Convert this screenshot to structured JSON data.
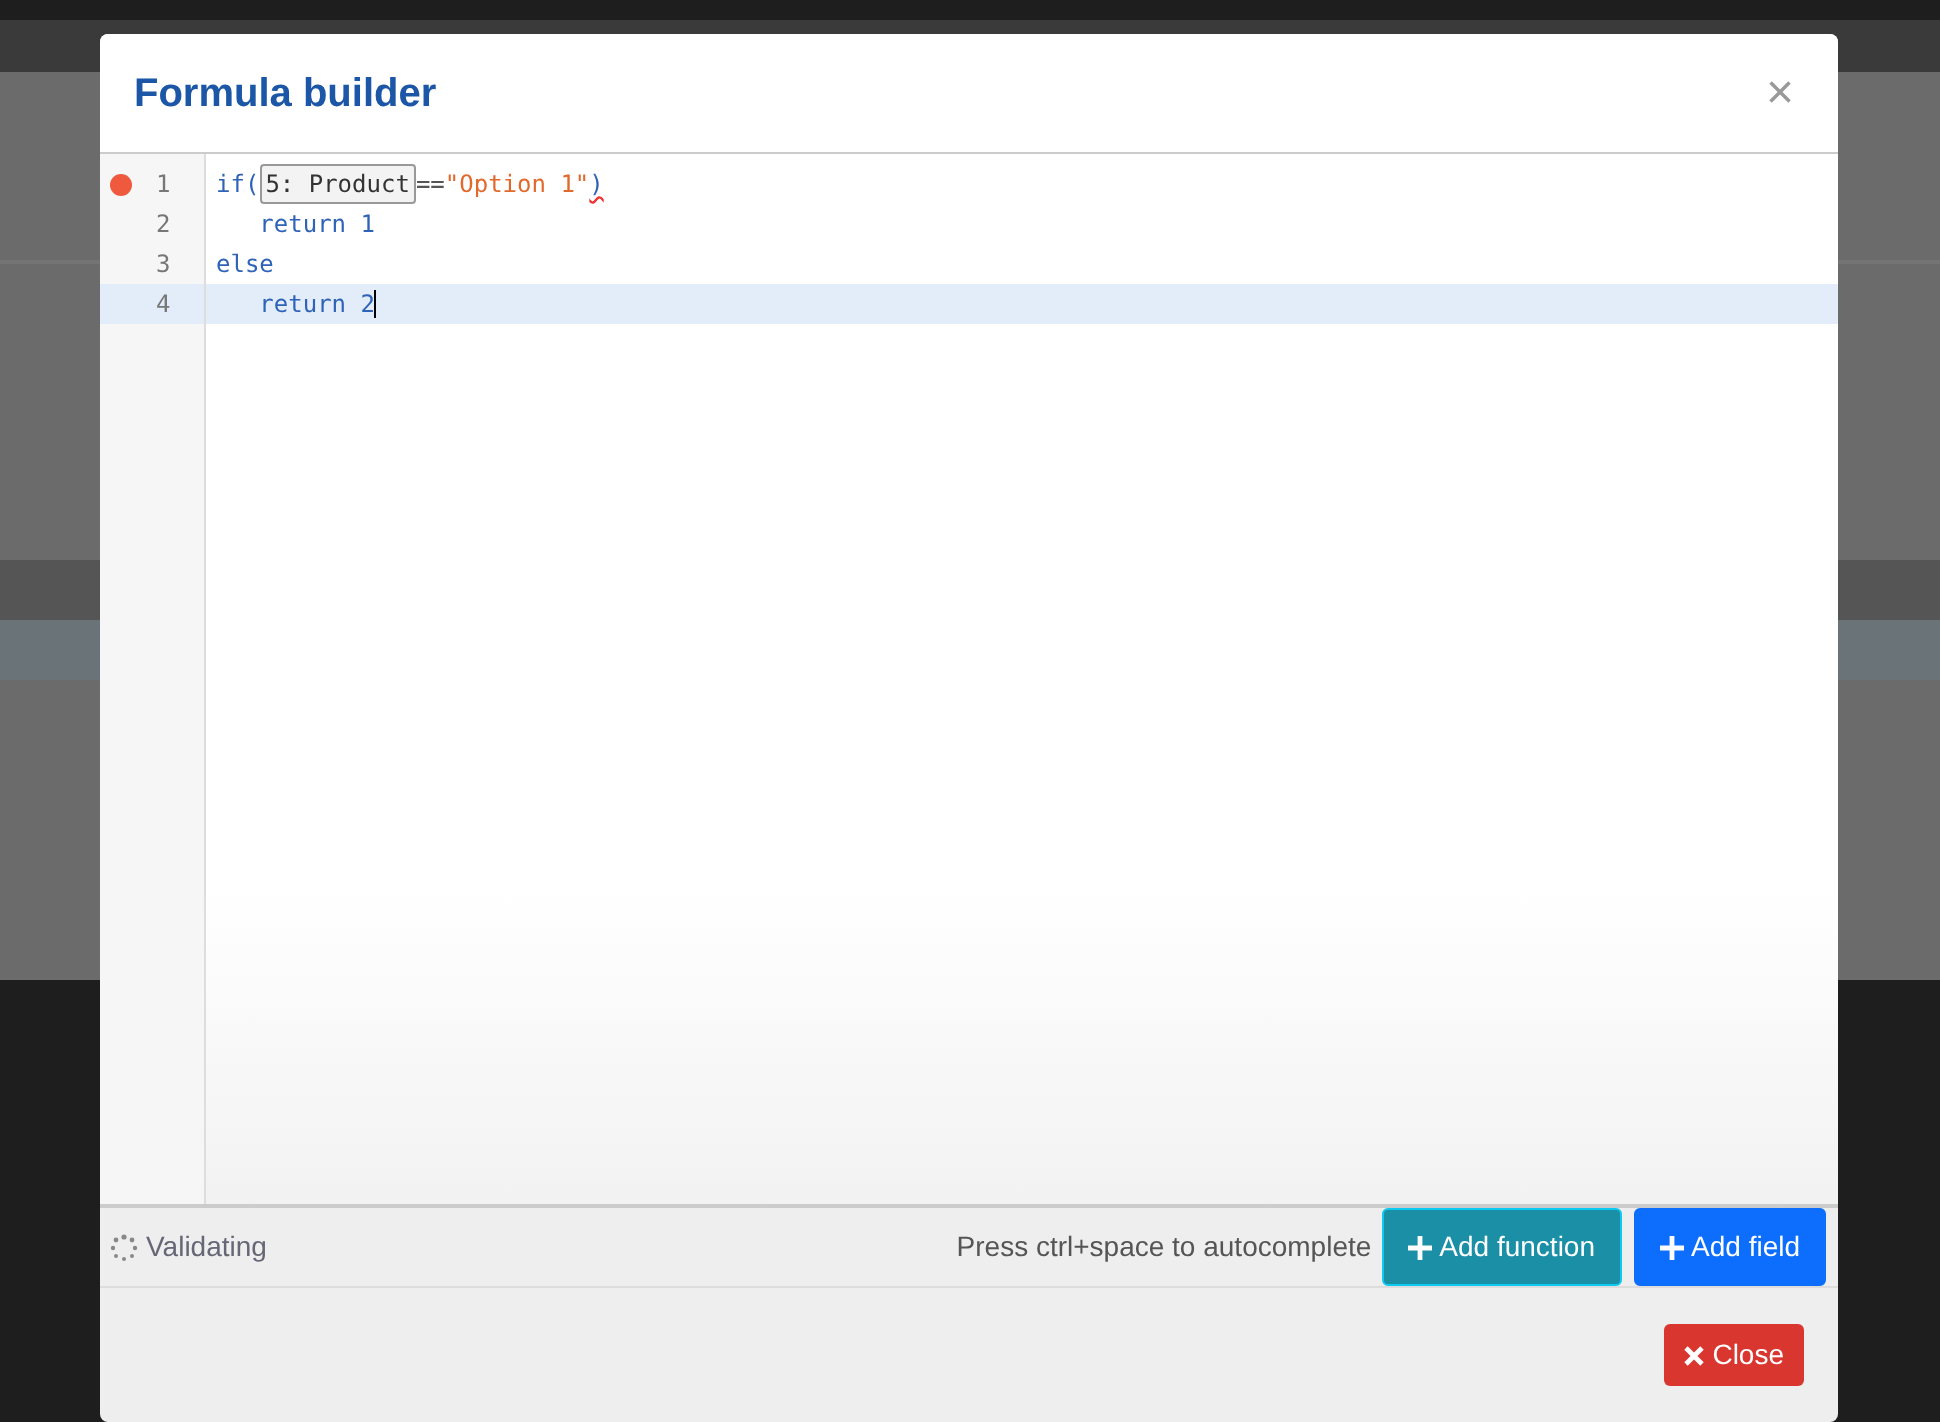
{
  "dialog": {
    "title": "Formula builder",
    "close_symbol": "×"
  },
  "editor": {
    "lines": [
      {
        "number": "1",
        "error": true,
        "active": false,
        "tokens": [
          {
            "kind": "keyword",
            "text": "if("
          },
          {
            "kind": "field",
            "text": "5: Product"
          },
          {
            "kind": "operator",
            "text": "=="
          },
          {
            "kind": "string",
            "text": "\"Option 1\""
          },
          {
            "kind": "bad",
            "text": ")"
          }
        ]
      },
      {
        "number": "2",
        "error": false,
        "active": false,
        "tokens": [
          {
            "kind": "keyword",
            "text": "   return 1"
          }
        ]
      },
      {
        "number": "3",
        "error": false,
        "active": false,
        "tokens": [
          {
            "kind": "keyword",
            "text": "else"
          }
        ]
      },
      {
        "number": "4",
        "error": false,
        "active": true,
        "tokens": [
          {
            "kind": "keyword",
            "text": "   return 2"
          }
        ]
      }
    ]
  },
  "status": {
    "validation": "Validating",
    "hint": "Press ctrl+space to autocomplete"
  },
  "tool_buttons": [
    {
      "kind": "info",
      "label": "Add function"
    },
    {
      "kind": "primary",
      "label": "Add field"
    }
  ],
  "footer": {
    "close_label": "Close"
  }
}
